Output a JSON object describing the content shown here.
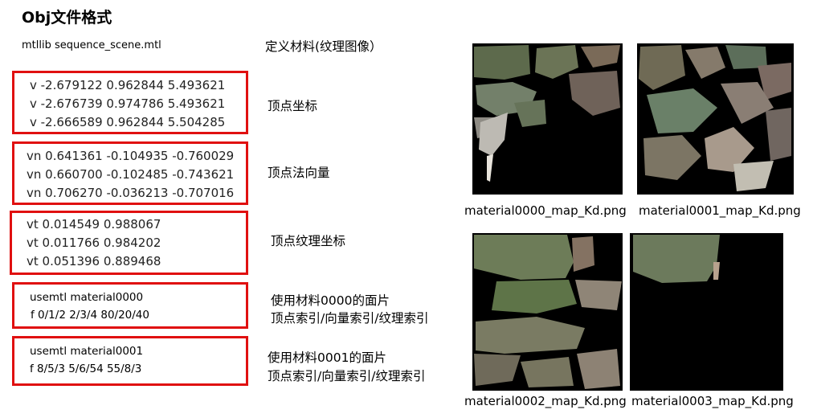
{
  "title": "Obj文件格式",
  "mtllib": "mtllib sequence_scene.mtl",
  "vertex_box": [
    "v -2.679122 0.962844 5.493621",
    "v -2.676739 0.974786 5.493621",
    "v -2.666589 0.962844 5.504285"
  ],
  "normal_box": [
    "vn 0.641361 -0.104935 -0.760029",
    "vn 0.660700 -0.102485 -0.743621",
    "vn 0.706270 -0.036213 -0.707016"
  ],
  "texcoord_box": [
    "vt 0.014549 0.988067",
    "vt 0.011766 0.984202",
    "vt 0.051396 0.889468"
  ],
  "face_box_1": [
    "usemtl material0000",
    "f  0/1/2   2/3/4   80/20/40"
  ],
  "face_box_2": [
    "usemtl material0001",
    "f 8/5/3   5/6/54   55/8/3"
  ],
  "labels": {
    "material_def": "定义材料(纹理图像）",
    "vertex": "顶点坐标",
    "normal": "顶点法向量",
    "texcoord": "顶点纹理坐标",
    "face1_a": "使用材料0000的面片",
    "face1_b": "顶点索引/向量索引/纹理索引",
    "face2_a": "使用材料0001的面片",
    "face2_b": "顶点索引/向量索引/纹理索引"
  },
  "textures": [
    "material0000_map_Kd.png",
    "material0001_map_Kd.png",
    "material0002_map_Kd.png",
    "material0003_map_Kd.png"
  ],
  "colors": {
    "box_border": "#e01010",
    "texture_bg": "#000000"
  }
}
